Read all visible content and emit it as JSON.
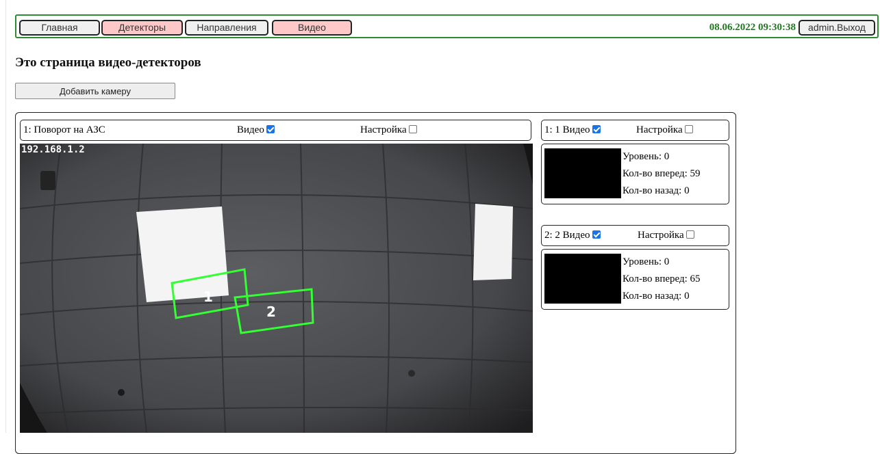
{
  "nav": {
    "home": "Главная",
    "detectors": "Детекторы",
    "directions": "Направления",
    "video": "Видео",
    "datetime": "08.06.2022 09:30:38",
    "logout": "admin.Выход"
  },
  "page_title": "Это страница видео-детекторов",
  "add_camera": "Добавить камеру",
  "camera": {
    "title": "1: Поворот на АЗС",
    "video_label": "Видео",
    "video_checked": true,
    "settings_label": "Настройка",
    "settings_checked": false,
    "overlay_ip": "192.168.1.2",
    "zone_labels": [
      "1",
      "2"
    ]
  },
  "detectors": [
    {
      "title": "1: 1 Видео",
      "video_checked": true,
      "settings_label": "Настройка",
      "settings_checked": false,
      "level": "Уровень: 0",
      "forward": "Кол-во вперед: 59",
      "backward": "Кол-во назад: 0"
    },
    {
      "title": "2: 2 Видео",
      "video_checked": true,
      "settings_label": "Настройка",
      "settings_checked": false,
      "level": "Уровень: 0",
      "forward": "Кол-во вперед: 65",
      "backward": "Кол-во назад: 0"
    }
  ],
  "colors": {
    "nav_border": "#2e8b2e",
    "active_button": "#ffc8c8",
    "detection_zone": "#33ff33",
    "checkbox_checked": "#1a73e8"
  }
}
